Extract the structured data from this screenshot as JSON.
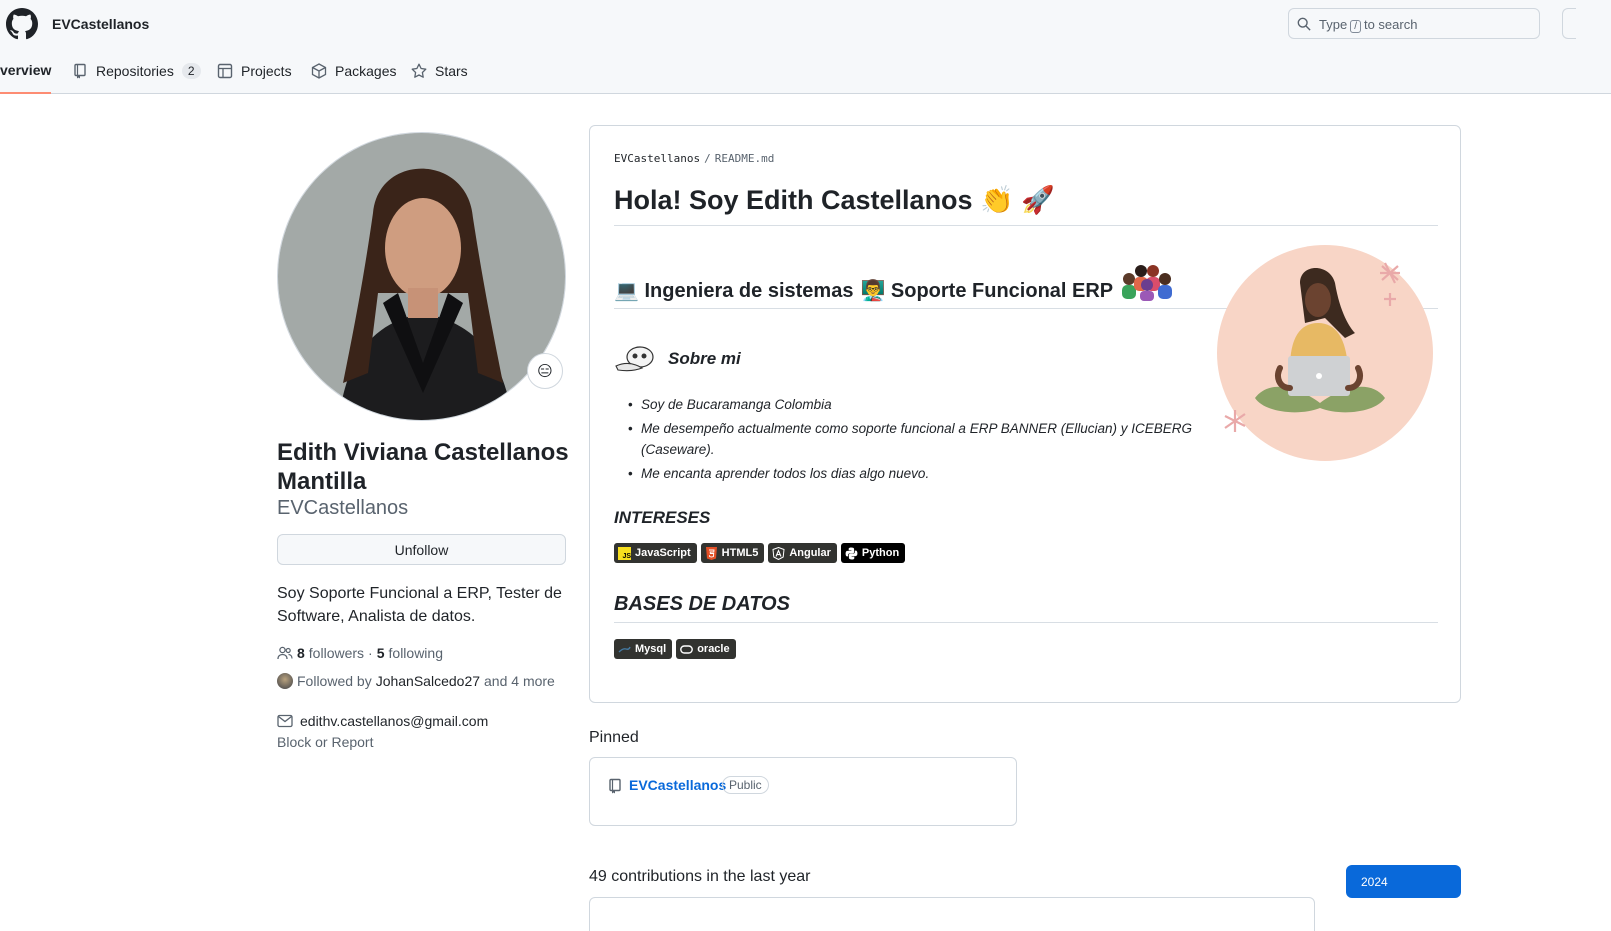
{
  "header": {
    "owner": "EVCastellanos",
    "search_prefix": "Type",
    "search_key": "/",
    "search_suffix": "to search"
  },
  "tabs": [
    {
      "label": "verview",
      "icon": "book-icon"
    },
    {
      "label": "Repositories",
      "icon": "repo-icon",
      "count": "2"
    },
    {
      "label": "Projects",
      "icon": "table-icon"
    },
    {
      "label": "Packages",
      "icon": "package-icon"
    },
    {
      "label": "Stars",
      "icon": "star-icon"
    }
  ],
  "profile": {
    "status_emoji": "😑",
    "full_name": "Edith Viviana Castellanos Mantilla",
    "login": "EVCastellanos",
    "unfollow_label": "Unfollow",
    "bio": "Soy Soporte Funcional a ERP, Tester de Software, Analista de datos.",
    "followers_count": "8",
    "followers_label": "followers",
    "dot": "·",
    "following_count": "5",
    "following_label": "following",
    "followed_by_prefix": "Followed by",
    "followed_by_user": "JohanSalcedo27",
    "followed_by_suffix": "and 4 more",
    "email": "edithv.castellanos@gmail.com",
    "block_report": "Block or Report"
  },
  "readme": {
    "crumb_owner": "EVCastellanos",
    "crumb_sep": "/",
    "crumb_file": "README.md",
    "title": "Hola! Soy Edith Castellanos 👏 🚀",
    "subtitle_part1": "💻 Ingeniera de sistemas",
    "subtitle_part2": "👨‍🏫 Soporte Funcional ERP",
    "sobre_title": "Sobre mi",
    "bullets": [
      "Soy de Bucaramanga Colombia",
      "Me desempeño actualmente como soporte funcional a ERP BANNER (Ellucian) y ICEBERG (Caseware).",
      "Me encanta aprender todos los dias algo nuevo."
    ],
    "intereses_title": "INTERESES",
    "interest_badges": [
      {
        "label": "JavaScript",
        "color": "#323330",
        "icon_color": "#F7DF1E",
        "icon_text": "JS"
      },
      {
        "label": "HTML5",
        "color": "#323330",
        "icon_color": "#E34F26",
        "icon_text": "5"
      },
      {
        "label": "Angular",
        "color": "#323330",
        "icon_color": "#ffffff",
        "icon_text": "A"
      },
      {
        "label": "Python",
        "color": "#000000",
        "icon_color": "#ffffff",
        "icon_text": "P"
      }
    ],
    "bases_title": "BASES DE DATOS",
    "db_badges": [
      {
        "label": "Mysql",
        "color": "#323330"
      },
      {
        "label": "oracle",
        "color": "#323330"
      }
    ]
  },
  "pinned": {
    "title": "Pinned",
    "repo_name": "EVCastellanos",
    "visibility": "Public"
  },
  "contributions": {
    "summary": "49 contributions in the last year",
    "year": "2024"
  },
  "colors": {
    "accent_link": "#0969da",
    "tab_underline": "#fd8c73",
    "illustration_bg": "#f8d5c6"
  }
}
